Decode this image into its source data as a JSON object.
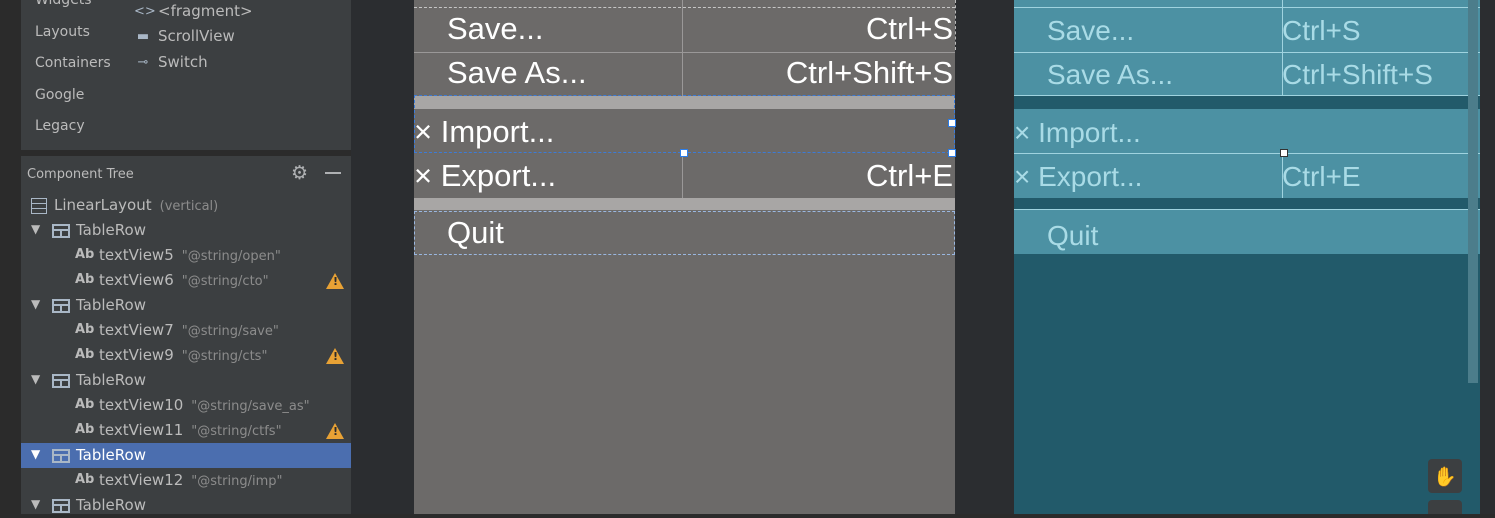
{
  "palette": {
    "categories": [
      "Widgets",
      "Layouts",
      "Containers",
      "Google",
      "Legacy"
    ],
    "items": [
      {
        "icon": "fragment-icon",
        "glyph": "<>",
        "label": "<fragment>"
      },
      {
        "icon": "scrollview-icon",
        "glyph": "▬",
        "label": "ScrollView"
      },
      {
        "icon": "switch-icon",
        "glyph": "⊸",
        "label": "Switch"
      }
    ]
  },
  "component_tree": {
    "title": "Component Tree",
    "rows": [
      {
        "kind": "linearlayout",
        "label": "LinearLayout",
        "sub": "(vertical)"
      },
      {
        "kind": "tablerow",
        "label": "TableRow"
      },
      {
        "kind": "text",
        "label": "textView5",
        "sub": "\"@string/open\""
      },
      {
        "kind": "text",
        "label": "textView6",
        "sub": "\"@string/cto\"",
        "warning": true
      },
      {
        "kind": "tablerow",
        "label": "TableRow"
      },
      {
        "kind": "text",
        "label": "textView7",
        "sub": "\"@string/save\""
      },
      {
        "kind": "text",
        "label": "textView9",
        "sub": "\"@string/cts\"",
        "warning": true
      },
      {
        "kind": "tablerow",
        "label": "TableRow"
      },
      {
        "kind": "text",
        "label": "textView10",
        "sub": "\"@string/save_as\""
      },
      {
        "kind": "text",
        "label": "textView11",
        "sub": "\"@string/ctfs\"",
        "warning": true
      },
      {
        "kind": "tablerow",
        "label": "TableRow",
        "selected": true
      },
      {
        "kind": "text",
        "label": "textView12",
        "sub": "\"@string/imp\""
      },
      {
        "kind": "tablerow",
        "label": "TableRow"
      }
    ],
    "text_prefix": "Ab",
    "warning_glyph": "!"
  },
  "design": {
    "save_label": "Save...",
    "save_shortcut": "Ctrl+S",
    "save_as_label": "Save As...",
    "save_as_shortcut": "Ctrl+Shift+S",
    "import_label": "× Import...",
    "export_label": "× Export...",
    "export_shortcut": "Ctrl+E",
    "quit_label": "Quit"
  },
  "blueprint": {
    "save_label": "Save...",
    "save_shortcut": "Ctrl+S",
    "save_as_label": "Save As...",
    "save_as_shortcut": "Ctrl+Shift+S",
    "import_label": "× Import...",
    "export_label": "× Export...",
    "export_shortcut": "Ctrl+E",
    "quit_label": "Quit"
  },
  "tools": {
    "pan_glyph": "✋"
  },
  "colors": {
    "selected_row": "#4b6eaf",
    "warning": "#e8a235",
    "design_bg": "#6c6a69",
    "blueprint_bg": "#225a6a"
  }
}
